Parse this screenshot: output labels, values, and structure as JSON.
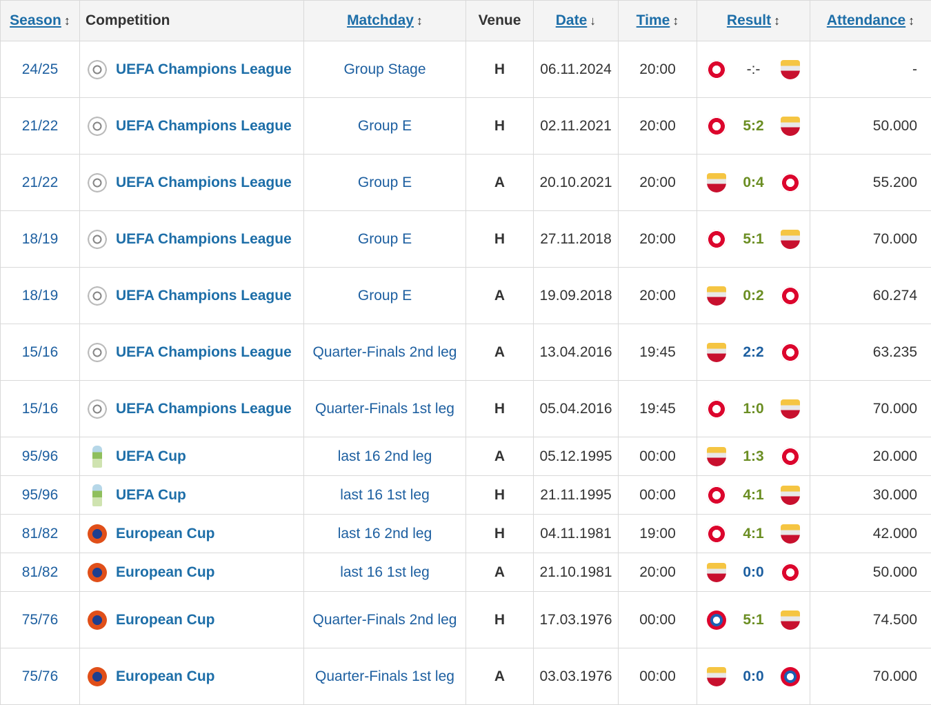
{
  "headers": {
    "season": "Season",
    "competition": "Competition",
    "matchday": "Matchday",
    "venue": "Venue",
    "date": "Date",
    "time": "Time",
    "result": "Result",
    "attendance": "Attendance",
    "sort_both": "↕",
    "sort_down": "↓"
  },
  "rows": [
    {
      "season": "24/25",
      "competition": "UEFA Champions League",
      "comp_icon": "ucl-logo",
      "matchday": "Group Stage",
      "venue": "H",
      "date": "06.11.2024",
      "time": "20:00",
      "home_crest": "bayern",
      "score": "-:-",
      "away_crest": "benfica",
      "attendance": "-"
    },
    {
      "season": "21/22",
      "competition": "UEFA Champions League",
      "comp_icon": "ucl-logo",
      "matchday": "Group E",
      "venue": "H",
      "date": "02.11.2021",
      "time": "20:00",
      "home_crest": "bayern",
      "score": "5:2",
      "away_crest": "benfica",
      "attendance": "50.000"
    },
    {
      "season": "21/22",
      "competition": "UEFA Champions League",
      "comp_icon": "ucl-logo",
      "matchday": "Group E",
      "venue": "A",
      "date": "20.10.2021",
      "time": "20:00",
      "home_crest": "benfica",
      "score": "0:4",
      "away_crest": "bayern",
      "attendance": "55.200"
    },
    {
      "season": "18/19",
      "competition": "UEFA Champions League",
      "comp_icon": "ucl-logo",
      "matchday": "Group E",
      "venue": "H",
      "date": "27.11.2018",
      "time": "20:00",
      "home_crest": "bayern",
      "score": "5:1",
      "away_crest": "benfica",
      "attendance": "70.000"
    },
    {
      "season": "18/19",
      "competition": "UEFA Champions League",
      "comp_icon": "ucl-logo",
      "matchday": "Group E",
      "venue": "A",
      "date": "19.09.2018",
      "time": "20:00",
      "home_crest": "benfica",
      "score": "0:2",
      "away_crest": "bayern",
      "attendance": "60.274"
    },
    {
      "season": "15/16",
      "competition": "UEFA Champions League",
      "comp_icon": "ucl-logo",
      "matchday": "Quarter-Finals 2nd leg",
      "venue": "A",
      "date": "13.04.2016",
      "time": "19:45",
      "home_crest": "benfica",
      "score": "2:2",
      "away_crest": "bayern",
      "attendance": "63.235"
    },
    {
      "season": "15/16",
      "competition": "UEFA Champions League",
      "comp_icon": "ucl-logo",
      "matchday": "Quarter-Finals 1st leg",
      "venue": "H",
      "date": "05.04.2016",
      "time": "19:45",
      "home_crest": "bayern",
      "score": "1:0",
      "away_crest": "benfica",
      "attendance": "70.000"
    },
    {
      "season": "95/96",
      "competition": "UEFA Cup",
      "comp_icon": "uefa-cup-logo",
      "matchday": "last 16 2nd leg",
      "venue": "A",
      "date": "05.12.1995",
      "time": "00:00",
      "home_crest": "benfica",
      "score": "1:3",
      "away_crest": "bayern",
      "attendance": "20.000"
    },
    {
      "season": "95/96",
      "competition": "UEFA Cup",
      "comp_icon": "uefa-cup-logo",
      "matchday": "last 16 1st leg",
      "venue": "H",
      "date": "21.11.1995",
      "time": "00:00",
      "home_crest": "bayern",
      "score": "4:1",
      "away_crest": "benfica",
      "attendance": "30.000"
    },
    {
      "season": "81/82",
      "competition": "European Cup",
      "comp_icon": "ec-logo",
      "matchday": "last 16 2nd leg",
      "venue": "H",
      "date": "04.11.1981",
      "time": "19:00",
      "home_crest": "bayern",
      "score": "4:1",
      "away_crest": "benfica",
      "attendance": "42.000"
    },
    {
      "season": "81/82",
      "competition": "European Cup",
      "comp_icon": "ec-logo",
      "matchday": "last 16 1st leg",
      "venue": "A",
      "date": "21.10.1981",
      "time": "20:00",
      "home_crest": "benfica",
      "score": "0:0",
      "away_crest": "bayern",
      "attendance": "50.000"
    },
    {
      "season": "75/76",
      "competition": "European Cup",
      "comp_icon": "ec-logo",
      "matchday": "Quarter-Finals 2nd leg",
      "venue": "H",
      "date": "17.03.1976",
      "time": "00:00",
      "home_crest": "bayern-old",
      "score": "5:1",
      "away_crest": "benfica",
      "attendance": "74.500"
    },
    {
      "season": "75/76",
      "competition": "European Cup",
      "comp_icon": "ec-logo",
      "matchday": "Quarter-Finals 1st leg",
      "venue": "A",
      "date": "03.03.1976",
      "time": "00:00",
      "home_crest": "benfica",
      "score": "0:0",
      "away_crest": "bayern-old",
      "attendance": "70.000"
    }
  ]
}
